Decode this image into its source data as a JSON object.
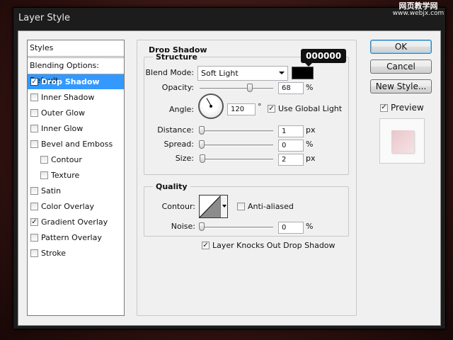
{
  "window": {
    "title": "Layer Style"
  },
  "watermark": {
    "line1": "网页教学网",
    "line2": "www.webjx.com"
  },
  "styles_panel": {
    "header": "Styles",
    "blending_options": "Blending Options: Default",
    "items": [
      {
        "label": "Drop Shadow",
        "checked": true,
        "selected": true,
        "indent": false
      },
      {
        "label": "Inner Shadow",
        "checked": false,
        "selected": false,
        "indent": false
      },
      {
        "label": "Outer Glow",
        "checked": false,
        "selected": false,
        "indent": false
      },
      {
        "label": "Inner Glow",
        "checked": false,
        "selected": false,
        "indent": false
      },
      {
        "label": "Bevel and Emboss",
        "checked": false,
        "selected": false,
        "indent": false
      },
      {
        "label": "Contour",
        "checked": false,
        "selected": false,
        "indent": true
      },
      {
        "label": "Texture",
        "checked": false,
        "selected": false,
        "indent": true
      },
      {
        "label": "Satin",
        "checked": false,
        "selected": false,
        "indent": false
      },
      {
        "label": "Color Overlay",
        "checked": false,
        "selected": false,
        "indent": false
      },
      {
        "label": "Gradient Overlay",
        "checked": true,
        "selected": false,
        "indent": false
      },
      {
        "label": "Pattern Overlay",
        "checked": false,
        "selected": false,
        "indent": false
      },
      {
        "label": "Stroke",
        "checked": false,
        "selected": false,
        "indent": false
      }
    ]
  },
  "drop_shadow": {
    "title": "Drop Shadow",
    "structure": {
      "legend": "Structure",
      "blend_mode_label": "Blend Mode:",
      "blend_mode_value": "Soft Light",
      "color_hex": "000000",
      "color": "#000000",
      "opacity_label": "Opacity:",
      "opacity_value": "68",
      "opacity_unit": "%",
      "opacity_fraction": 0.68,
      "angle_label": "Angle:",
      "angle_value": "120",
      "angle_unit": "°",
      "use_global_light_label": "Use Global Light",
      "use_global_light_checked": true,
      "distance_label": "Distance:",
      "distance_value": "1",
      "distance_unit": "px",
      "spread_label": "Spread:",
      "spread_value": "0",
      "spread_unit": "%",
      "size_label": "Size:",
      "size_value": "2",
      "size_unit": "px"
    },
    "quality": {
      "legend": "Quality",
      "contour_label": "Contour:",
      "anti_aliased_label": "Anti-aliased",
      "anti_aliased_checked": false,
      "noise_label": "Noise:",
      "noise_value": "0",
      "noise_unit": "%"
    },
    "knocks_out_label": "Layer Knocks Out Drop Shadow",
    "knocks_out_checked": true
  },
  "buttons": {
    "ok": "OK",
    "cancel": "Cancel",
    "new_style": "New Style...",
    "preview_label": "Preview",
    "preview_checked": true
  }
}
